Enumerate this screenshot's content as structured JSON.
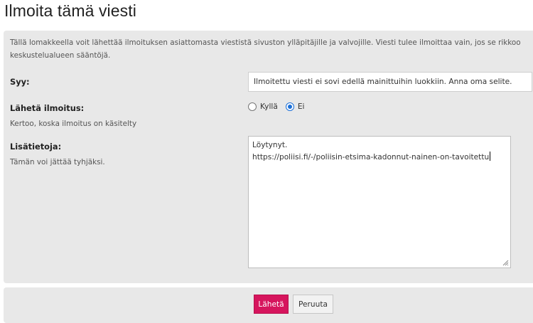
{
  "page": {
    "title": "Ilmoita tämä viesti"
  },
  "form": {
    "intro": "Tällä lomakkeella voit lähettää ilmoituksen asiattomasta viestistä sivuston ylläpitäjille ja valvojille. Viesti tulee ilmoittaa vain, jos se rikkoo keskustelualueen sääntöjä.",
    "reason": {
      "label": "Syy:",
      "value": "Ilmoitettu viesti ei sovi edellä mainittuihin luokkiin. Anna oma selite."
    },
    "notify": {
      "label": "Lähetä ilmoitus:",
      "hint": "Kertoo, koska ilmoitus on käsitelty",
      "options": [
        {
          "label": "Kyllä",
          "checked": false
        },
        {
          "label": "Ei",
          "checked": true
        }
      ]
    },
    "details": {
      "label": "Lisätietoja:",
      "hint": "Tämän voi jättää tyhjäksi.",
      "lines": [
        "Löytynyt.",
        "https://poliisi.fi/-/poliisin-etsima-kadonnut-nainen-on-tavoitettu"
      ]
    }
  },
  "buttons": {
    "send": "Lähetä",
    "cancel": "Peruuta"
  },
  "colors": {
    "accent": "#d6155d",
    "radio": "#1a6fd8",
    "panel": "#e8e8e8"
  }
}
